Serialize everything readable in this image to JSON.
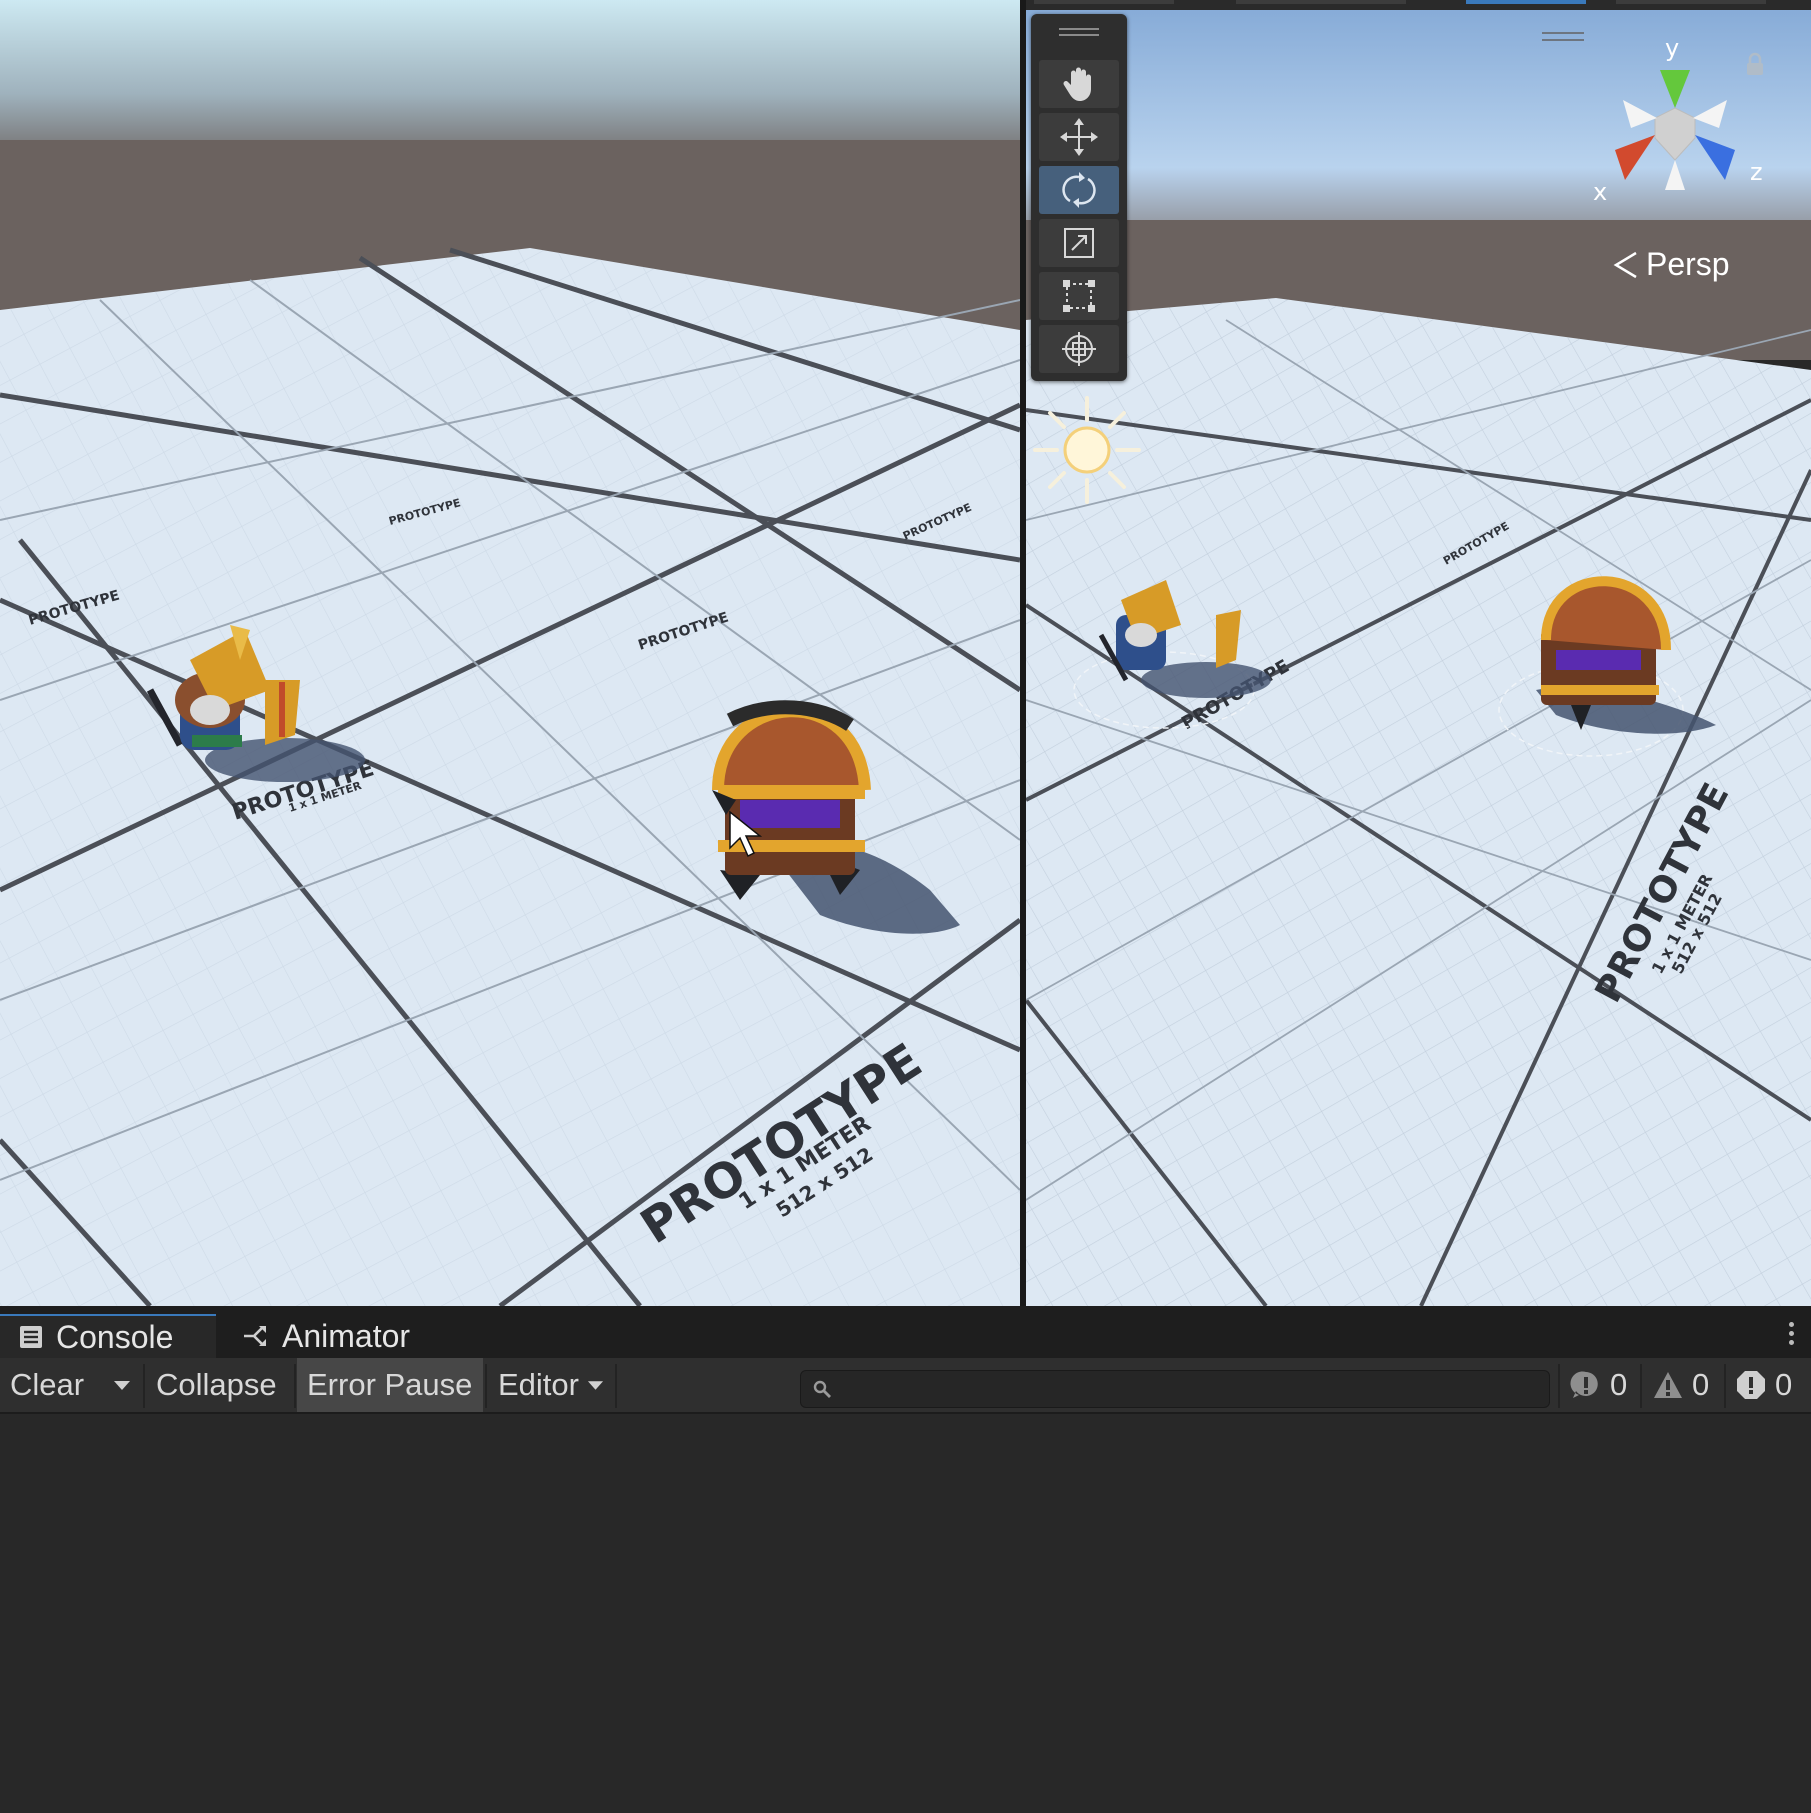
{
  "scene": {
    "projection_label": "Persp",
    "gizmo_axes": {
      "x": "x",
      "y": "y",
      "z": "z"
    },
    "tools": [
      {
        "name": "hand-tool",
        "icon": "hand-icon",
        "active": false
      },
      {
        "name": "move-tool",
        "icon": "move-arrows-icon",
        "active": false
      },
      {
        "name": "rotate-tool",
        "icon": "rotate-icon",
        "active": true
      },
      {
        "name": "scale-tool",
        "icon": "scale-icon",
        "active": false
      },
      {
        "name": "rect-tool",
        "icon": "rect-transform-icon",
        "active": false
      },
      {
        "name": "transform-tool",
        "icon": "transform-icon",
        "active": false
      }
    ],
    "floor_texts": [
      "PROTOTYPE",
      "1 x 1 METER",
      "512 x 512"
    ]
  },
  "console": {
    "tabs": [
      {
        "label": "Console",
        "icon": "console-icon",
        "active": true
      },
      {
        "label": "Animator",
        "icon": "animator-icon",
        "active": false
      }
    ],
    "toolbar": {
      "clear_label": "Clear",
      "collapse_label": "Collapse",
      "error_pause_label": "Error Pause",
      "editor_label": "Editor"
    },
    "search": {
      "value": "",
      "placeholder": ""
    },
    "counts": {
      "info": "0",
      "warnings": "0",
      "errors": "0"
    }
  },
  "colors": {
    "sky_top": "#c9e7f0",
    "horizon": "#6b625f",
    "floor": "#dde8f3",
    "grid_major": "#4b4f57",
    "panel_bg": "#282828",
    "toolbar_bg": "#2f2f2f",
    "active_tool": "#46607c",
    "gizmo_x": "#d24a2e",
    "gizmo_y": "#64c83c",
    "gizmo_z": "#3a6fe0"
  }
}
